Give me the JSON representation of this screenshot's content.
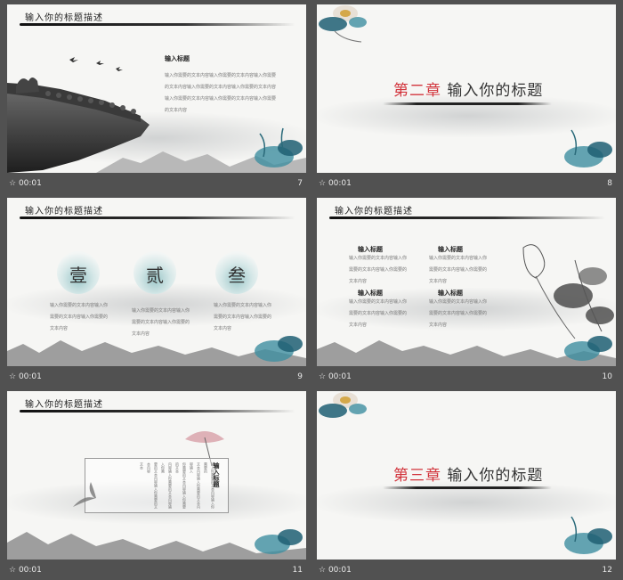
{
  "slides": [
    {
      "time": "00:01",
      "number": "7",
      "header": "输入你的标题描述",
      "subtitle": "输入标题",
      "body": [
        "输入你需要的文本内容输入你需要的文本内容输入你需要",
        "的文本内容输入你需要的文本内容输入你需要的文本内容",
        "输入你需要的文本内容输入你需要的文本内容输入你需要",
        "的文本内容"
      ]
    },
    {
      "time": "00:01",
      "number": "8",
      "chapter_red": "第二章",
      "chapter_title": "输入你的标题"
    },
    {
      "time": "00:01",
      "number": "9",
      "header": "输入你的标题描述",
      "numerals": [
        "壹",
        "贰",
        "叁"
      ],
      "body": [
        [
          "输入你需要的文本内容输入你",
          "需要的文本内容输入你需要的",
          "文本内容"
        ],
        [
          "输入你需要的文本内容输入你",
          "需要的文本内容输入你需要的",
          "文本内容"
        ],
        [
          "输入你需要的文本内容输入你",
          "需要的文本内容输入你需要的",
          "文本内容"
        ]
      ]
    },
    {
      "time": "00:01",
      "number": "10",
      "header": "输入你的标题描述",
      "blocks": [
        {
          "title": "输入标题",
          "lines": [
            "输入你需要的文本内容输入你",
            "需要的文本内容输入你需要的",
            "文本内容"
          ]
        },
        {
          "title": "输入标题",
          "lines": [
            "输入你需要的文本内容输入你",
            "需要的文本内容输入你需要的",
            "文本内容"
          ]
        },
        {
          "title": "输入标题",
          "lines": [
            "输入你需要的文本内容输入你",
            "需要的文本内容输入你需要的",
            "文本内容"
          ]
        },
        {
          "title": "输入标题",
          "lines": [
            "输入你需要的文本内容输入你",
            "需要的文本内容输入你需要的",
            "文本内容"
          ]
        }
      ]
    },
    {
      "time": "00:01",
      "number": "11",
      "header": "输入你的标题描述",
      "vertical_title": "输入标题",
      "vertical_text": [
        "输入你需要的文本内容输入你需要的",
        "文本内容输入你需要的文本内容输入",
        "你需要的文本内容输入你需要的文本",
        "内容输入你需要的文本内容输入你需",
        "要的文本内容输入你需要的文本内容",
        "文本"
      ]
    },
    {
      "time": "00:01",
      "number": "12",
      "chapter_red": "第三章",
      "chapter_title": "输入你的标题"
    }
  ]
}
